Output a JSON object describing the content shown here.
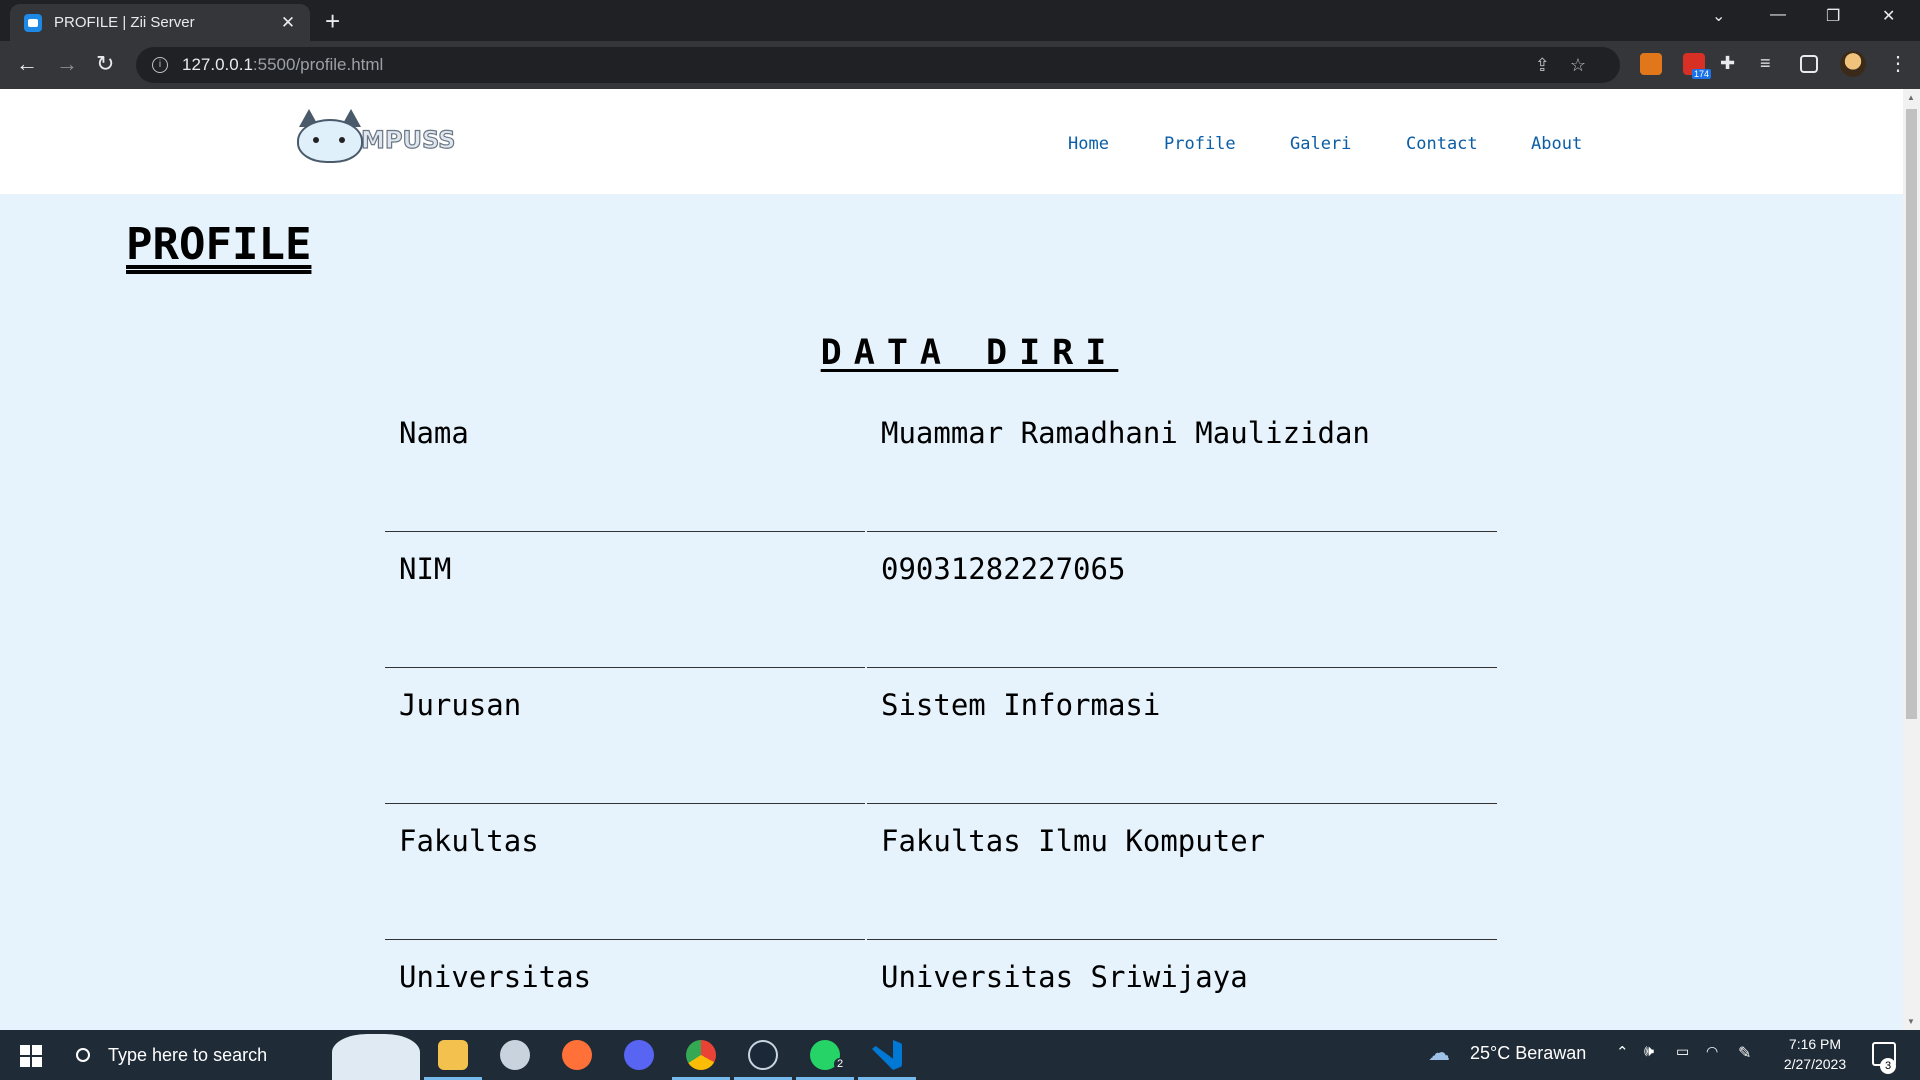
{
  "browser": {
    "tab_title": "PROFILE | Zii Server",
    "new_tab_label": "+",
    "url_host": "127.0.0.1",
    "url_path": ":5500/profile.html",
    "extension_badge": "174"
  },
  "header": {
    "logo_text": "MPUSS",
    "nav": [
      {
        "label": "Home"
      },
      {
        "label": "Profile"
      },
      {
        "label": "Galeri"
      },
      {
        "label": "Contact"
      },
      {
        "label": "About"
      }
    ]
  },
  "main": {
    "page_title": "PROFILE",
    "section_title": "DATA DIRI",
    "rows": [
      {
        "key": "Nama",
        "value": "Muammar Ramadhani Maulizidan"
      },
      {
        "key": "NIM",
        "value": "09031282227065"
      },
      {
        "key": "Jurusan",
        "value": "Sistem Informasi"
      },
      {
        "key": "Fakultas",
        "value": "Fakultas Ilmu Komputer"
      },
      {
        "key": "Universitas",
        "value": "Universitas Sriwijaya"
      }
    ]
  },
  "taskbar": {
    "search_placeholder": "Type here to search",
    "whatsapp_badge": "2",
    "weather": "25°C  Berawan",
    "time": "7:16 PM",
    "date": "2/27/2023",
    "notification_count": "3"
  },
  "colors": {
    "page_bg": "#e6f3fc",
    "nav_link": "#0a5da6",
    "taskbar_bg": "#1f2b36"
  }
}
